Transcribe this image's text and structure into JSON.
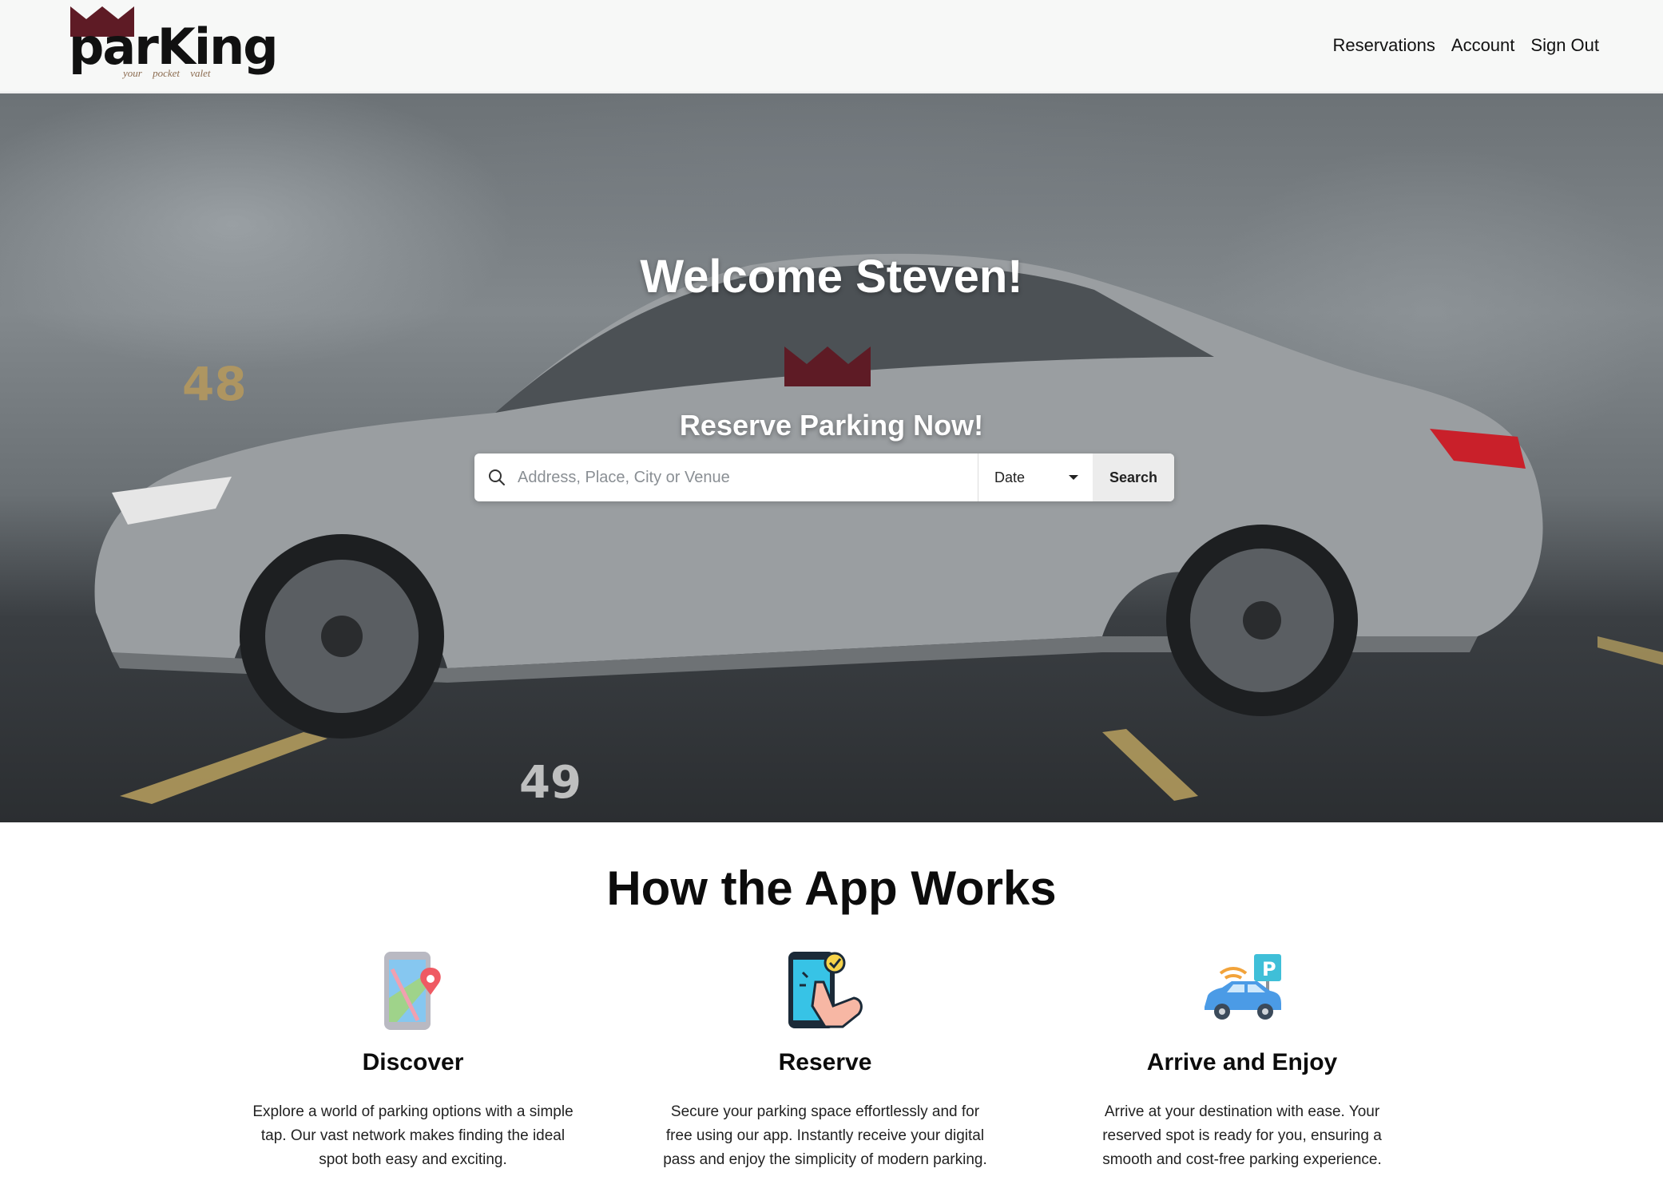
{
  "brand": {
    "name": "parKing",
    "tagline": "your pocket valet",
    "crown_color": "#5e1b25"
  },
  "nav": {
    "links": [
      "Reservations",
      "Account",
      "Sign Out"
    ]
  },
  "hero": {
    "welcome": "Welcome Steven!",
    "subtitle": "Reserve Parking Now!",
    "wall_numbers": [
      "48",
      "49"
    ],
    "floor_number": "49"
  },
  "search": {
    "placeholder": "Address, Place, City or Venue",
    "date_label": "Date",
    "button_label": "Search",
    "icon": "search-icon"
  },
  "how": {
    "title": "How the App Works",
    "steps": [
      {
        "icon": "map-phone-icon",
        "title": "Discover",
        "text": "Explore a world of parking options with a simple tap. Our vast network makes finding the ideal spot both easy and exciting."
      },
      {
        "icon": "tap-phone-icon",
        "title": "Reserve",
        "text": "Secure your parking space effortlessly and for free using our app. Instantly receive your digital pass and enjoy the simplicity of modern parking."
      },
      {
        "icon": "car-parking-icon",
        "title": "Arrive and Enjoy",
        "text": "Arrive at your destination with ease. Your reserved spot is ready for you, ensuring a smooth and cost-free parking experience."
      }
    ]
  }
}
